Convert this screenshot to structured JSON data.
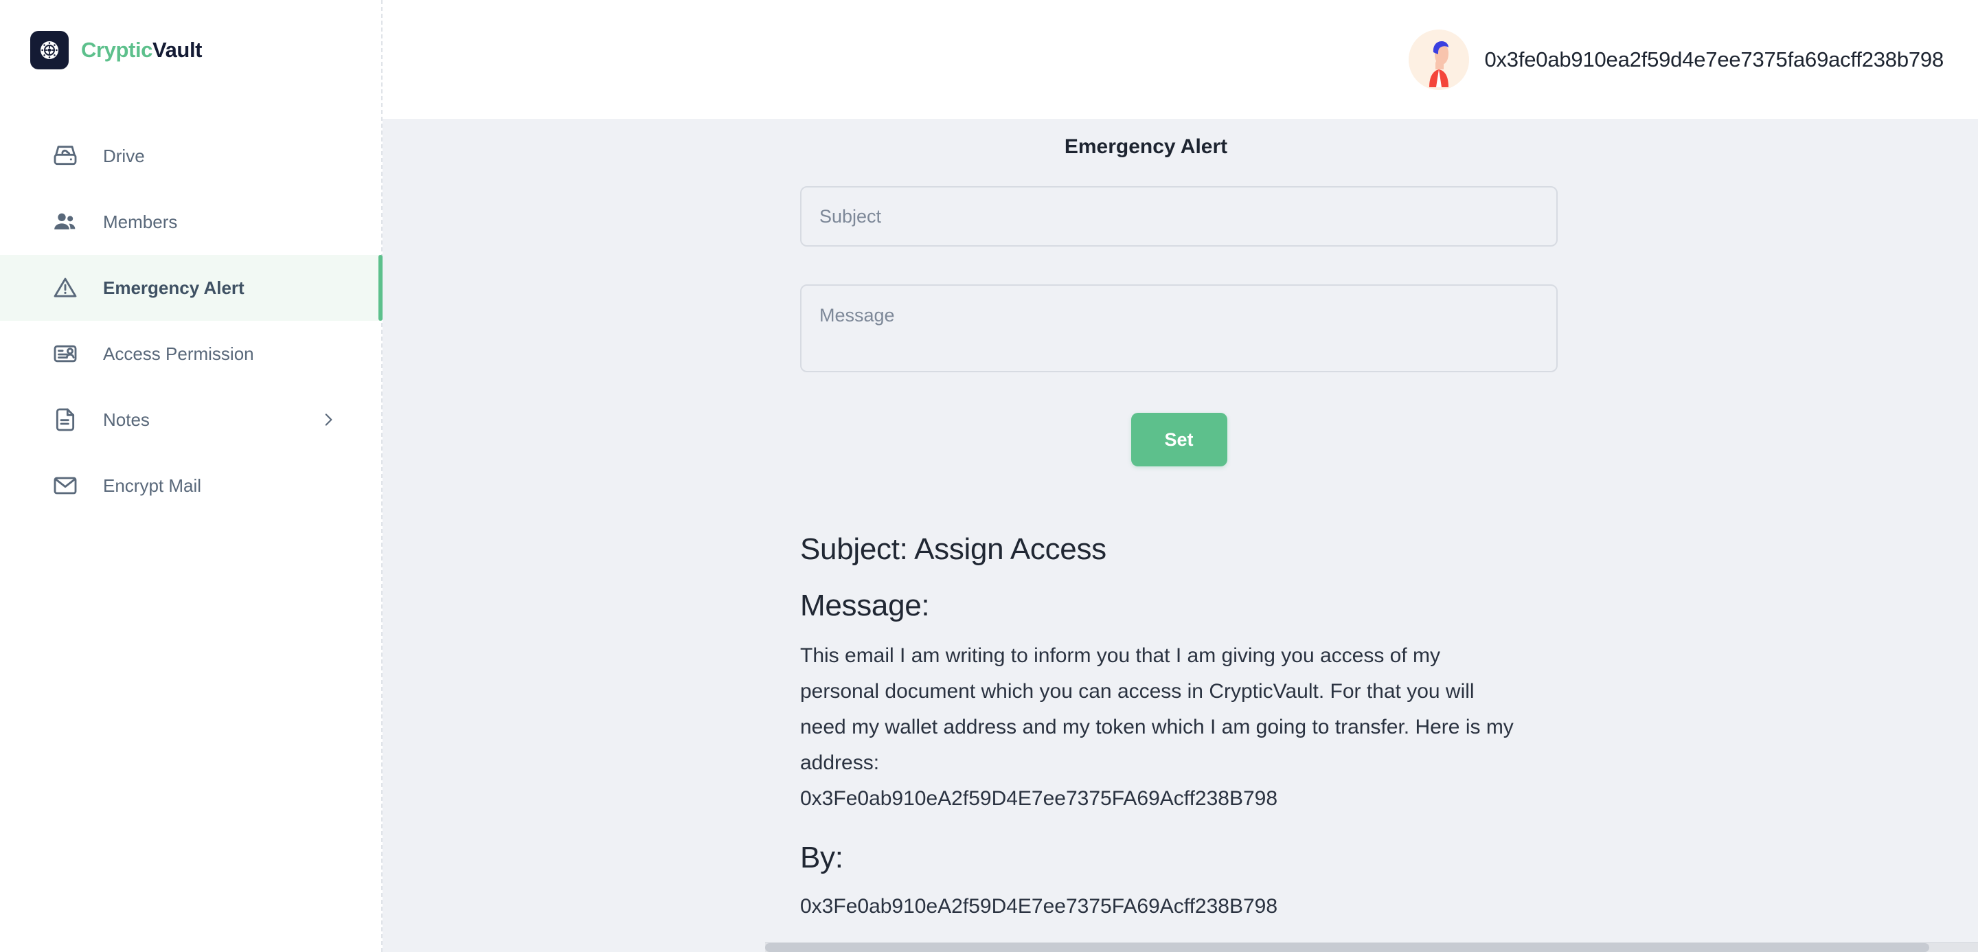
{
  "brand": {
    "name_part1": "Cryptic",
    "name_part2": "Vault",
    "logo_icon": "vault-dial-icon",
    "accent_color": "#5dc08c",
    "dark_color": "#141b34"
  },
  "sidebar": {
    "items": [
      {
        "label": "Drive",
        "icon": "hard-drive-cloud-icon",
        "active": false,
        "chevron": false
      },
      {
        "label": "Members",
        "icon": "people-icon",
        "active": false,
        "chevron": false
      },
      {
        "label": "Emergency Alert",
        "icon": "warning-triangle-icon",
        "active": true,
        "chevron": false
      },
      {
        "label": "Access Permission",
        "icon": "id-card-person-icon",
        "active": false,
        "chevron": false
      },
      {
        "label": "Notes",
        "icon": "document-lines-icon",
        "active": false,
        "chevron": true,
        "chevron_icon": "chevron-right-icon"
      },
      {
        "label": "Encrypt Mail",
        "icon": "envelope-icon",
        "active": false,
        "chevron": false
      }
    ]
  },
  "header": {
    "avatar_icon": "user-avatar-illustration",
    "wallet_address": "0x3fe0ab910ea2f59d4e7ee7375fa69acff238b798"
  },
  "main": {
    "title": "Emergency Alert",
    "form": {
      "subject_value": "",
      "subject_placeholder": "Subject",
      "message_value": "",
      "message_placeholder": "Message",
      "submit_label": "Set",
      "submit_color": "#5dc08c"
    },
    "result": {
      "subject_line": "Subject: Assign Access",
      "message_label": "Message:",
      "message_body": "This email I am writing to inform you that I am giving you access of my personal document which you can access in CrypticVault. For that you will need my wallet address and my token which I am going to transfer. Here is my address:",
      "message_address": "0x3Fe0ab910eA2f59D4E7ee7375FA69Acff238B798",
      "by_label": "By:",
      "by_address": "0x3Fe0ab910eA2f59D4E7ee7375FA69Acff238B798"
    }
  }
}
